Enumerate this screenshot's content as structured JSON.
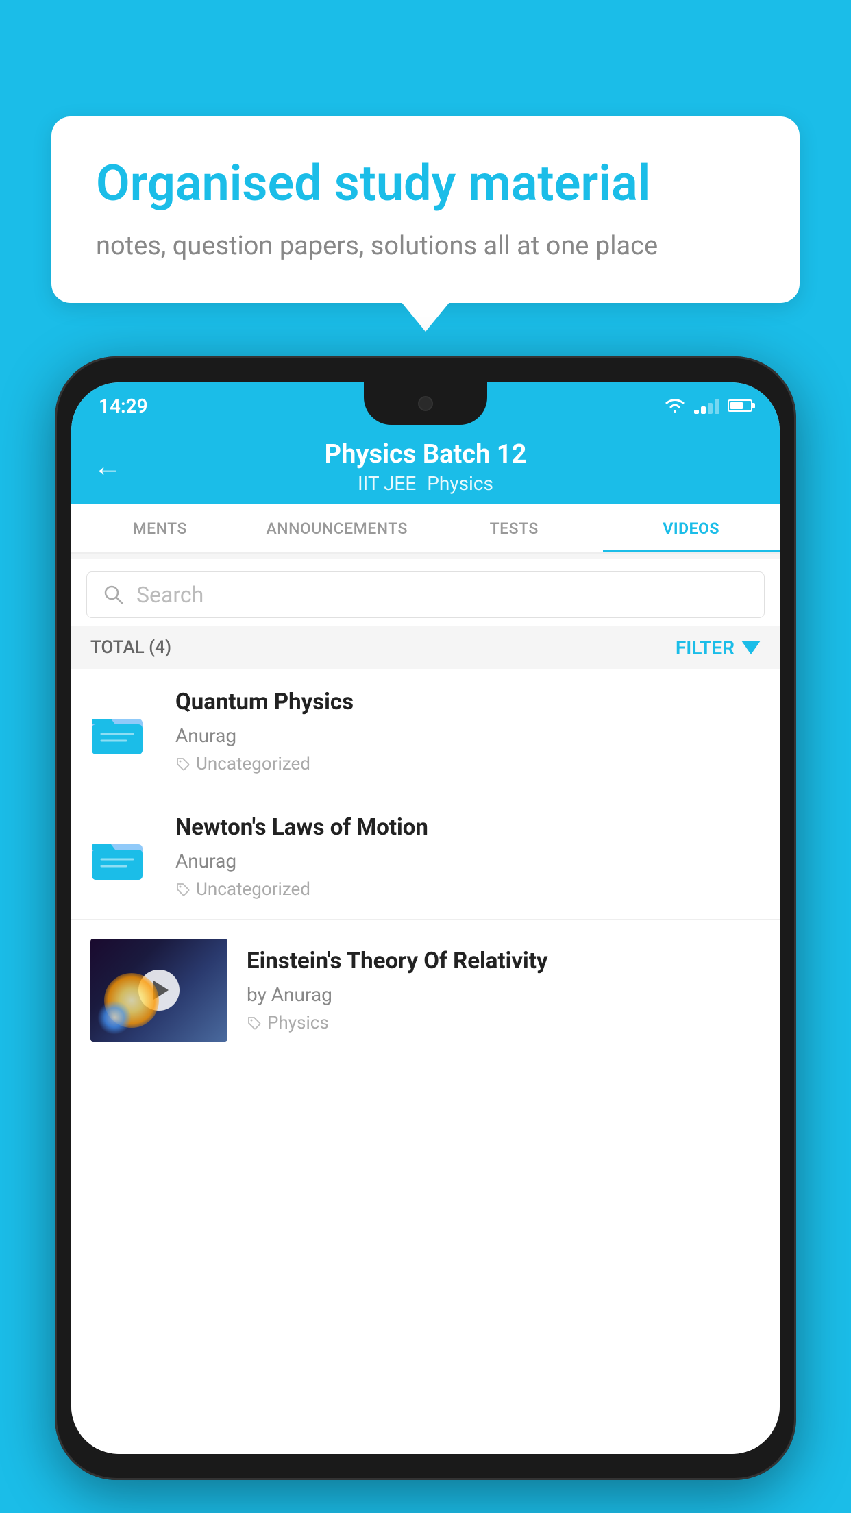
{
  "bubble": {
    "title": "Organised study material",
    "subtitle": "notes, question papers, solutions all at one place"
  },
  "statusBar": {
    "time": "14:29"
  },
  "header": {
    "title": "Physics Batch 12",
    "subtitle1": "IIT JEE",
    "subtitle2": "Physics",
    "backLabel": "←"
  },
  "tabs": [
    {
      "label": "MENTS",
      "active": false
    },
    {
      "label": "ANNOUNCEMENTS",
      "active": false
    },
    {
      "label": "TESTS",
      "active": false
    },
    {
      "label": "VIDEOS",
      "active": true
    }
  ],
  "search": {
    "placeholder": "Search"
  },
  "filterBar": {
    "total": "TOTAL (4)",
    "filterLabel": "FILTER"
  },
  "videos": [
    {
      "title": "Quantum Physics",
      "author": "Anurag",
      "tag": "Uncategorized",
      "type": "folder",
      "thumbnail": null
    },
    {
      "title": "Newton's Laws of Motion",
      "author": "Anurag",
      "tag": "Uncategorized",
      "type": "folder",
      "thumbnail": null
    },
    {
      "title": "Einstein's Theory Of Relativity",
      "author": "by Anurag",
      "tag": "Physics",
      "type": "video",
      "thumbnail": "space"
    }
  ]
}
